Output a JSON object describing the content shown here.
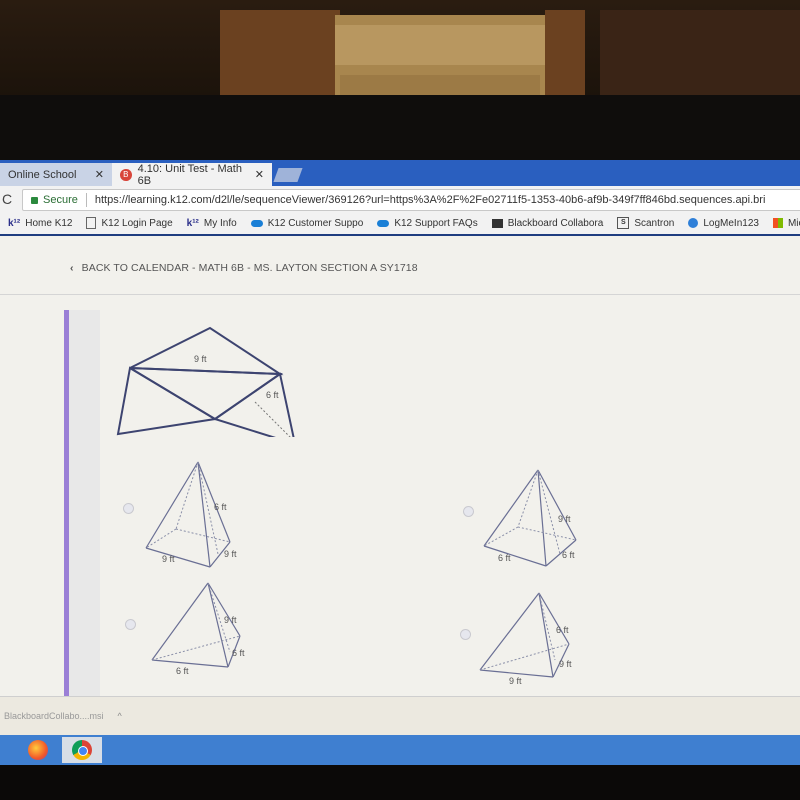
{
  "browser": {
    "tabs": [
      {
        "label": "Online School",
        "active": false
      },
      {
        "label": "4.10: Unit Test - Math 6B",
        "active": true
      }
    ],
    "address": {
      "secure_label": "Secure",
      "url": "https://learning.k12.com/d2l/le/sequenceViewer/369126?url=https%3A%2F%2Fe02711f5-1353-40b6-af9b-349f7ff846bd.sequences.api.bri"
    },
    "bookmarks": [
      {
        "label": "Home K12",
        "icon": "k12-icon"
      },
      {
        "label": "K12 Login Page",
        "icon": "document-icon"
      },
      {
        "label": "My Info",
        "icon": "k12-icon"
      },
      {
        "label": "K12 Customer Suppo",
        "icon": "cloud-icon"
      },
      {
        "label": "K12 Support FAQs",
        "icon": "cloud-icon"
      },
      {
        "label": "Blackboard Collabora",
        "icon": "blackboard-icon"
      },
      {
        "label": "Scantron",
        "icon": "scantron-icon"
      },
      {
        "label": "LogMeIn123",
        "icon": "logmein-icon"
      },
      {
        "label": "Micro",
        "icon": "microsoft-icon"
      }
    ]
  },
  "page": {
    "back_link": "BACK TO CALENDAR - MATH 6B - MS. LAYTON SECTION A SY1718",
    "net_figure": {
      "base_label": "9 ft",
      "slant_label": "6 ft"
    },
    "options": [
      {
        "id": "a",
        "shape": "square-pyramid",
        "labels": {
          "slant": "6 ft",
          "base_front": "9 ft",
          "base_side": "9 ft"
        },
        "selected": false
      },
      {
        "id": "b",
        "shape": "square-pyramid",
        "labels": {
          "slant": "9 ft",
          "base_front": "6 ft",
          "base_side": "6 ft"
        },
        "selected": false
      },
      {
        "id": "c",
        "shape": "triangular-pyramid",
        "labels": {
          "slant": "9 ft",
          "base_front": "6 ft",
          "base_side": "6 ft"
        },
        "selected": false
      },
      {
        "id": "d",
        "shape": "triangular-pyramid",
        "labels": {
          "slant": "6 ft",
          "base_front": "9 ft",
          "base_side": "9 ft"
        },
        "selected": false
      }
    ]
  },
  "downloads": {
    "item": "BlackboardCollabo....msi"
  },
  "taskbar": {
    "apps": [
      "firefox",
      "chrome"
    ]
  }
}
